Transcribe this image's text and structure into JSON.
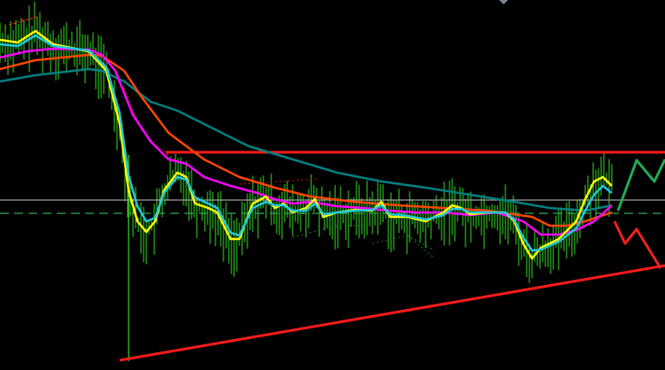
{
  "chart_data": {
    "type": "line",
    "title": "",
    "xlabel": "",
    "ylabel": "",
    "xlim": [
      0,
      150
    ],
    "ylim": [
      0,
      418
    ],
    "grid": false,
    "legend": "none",
    "background": "#000000",
    "bar_color": "#33dd22",
    "series": [
      {
        "name": "slow-ma-teal",
        "color": "#008080",
        "width": 2.5,
        "points": [
          [
            0,
            326
          ],
          [
            8,
            333
          ],
          [
            20,
            340
          ],
          [
            23,
            338
          ],
          [
            28,
            326
          ],
          [
            34,
            303
          ],
          [
            40,
            293
          ],
          [
            48,
            273
          ],
          [
            56,
            253
          ],
          [
            66,
            238
          ],
          [
            76,
            223
          ],
          [
            86,
            213
          ],
          [
            96,
            206
          ],
          [
            106,
            198
          ],
          [
            116,
            190
          ],
          [
            124,
            183
          ],
          [
            132,
            180
          ],
          [
            138,
            186
          ]
        ]
      },
      {
        "name": "ma-orange",
        "color": "#ff4500",
        "width": 2.5,
        "points": [
          [
            0,
            340
          ],
          [
            8,
            350
          ],
          [
            20,
            356
          ],
          [
            23,
            355
          ],
          [
            28,
            338
          ],
          [
            32,
            308
          ],
          [
            38,
            268
          ],
          [
            46,
            238
          ],
          [
            54,
            218
          ],
          [
            62,
            206
          ],
          [
            70,
            196
          ],
          [
            80,
            190
          ],
          [
            90,
            186
          ],
          [
            100,
            183
          ],
          [
            110,
            180
          ],
          [
            120,
            173
          ],
          [
            124,
            163
          ],
          [
            128,
            163
          ],
          [
            132,
            168
          ],
          [
            138,
            178
          ]
        ]
      },
      {
        "name": "ma-magenta",
        "color": "#ff00ff",
        "width": 2.5,
        "points": [
          [
            0,
            353
          ],
          [
            6,
            360
          ],
          [
            12,
            363
          ],
          [
            20,
            362
          ],
          [
            23,
            356
          ],
          [
            26,
            338
          ],
          [
            30,
            288
          ],
          [
            34,
            258
          ],
          [
            38,
            238
          ],
          [
            42,
            233
          ],
          [
            46,
            218
          ],
          [
            52,
            208
          ],
          [
            58,
            200
          ],
          [
            62,
            193
          ],
          [
            66,
            188
          ],
          [
            70,
            190
          ],
          [
            76,
            185
          ],
          [
            82,
            183
          ],
          [
            88,
            180
          ],
          [
            94,
            178
          ],
          [
            100,
            178
          ],
          [
            106,
            175
          ],
          [
            112,
            178
          ],
          [
            118,
            168
          ],
          [
            122,
            153
          ],
          [
            126,
            153
          ],
          [
            130,
            158
          ],
          [
            134,
            168
          ],
          [
            138,
            186
          ]
        ]
      },
      {
        "name": "fast-ma-yellow",
        "color": "#ffff00",
        "width": 2.5,
        "points": [
          [
            0,
            373
          ],
          [
            4,
            370
          ],
          [
            8,
            383
          ],
          [
            12,
            368
          ],
          [
            20,
            360
          ],
          [
            24,
            338
          ],
          [
            27,
            278
          ],
          [
            29,
            203
          ],
          [
            31,
            168
          ],
          [
            33,
            156
          ],
          [
            35,
            168
          ],
          [
            37,
            203
          ],
          [
            40,
            223
          ],
          [
            42,
            218
          ],
          [
            44,
            188
          ],
          [
            47,
            183
          ],
          [
            49,
            178
          ],
          [
            52,
            148
          ],
          [
            54,
            148
          ],
          [
            57,
            188
          ],
          [
            60,
            196
          ],
          [
            62,
            183
          ],
          [
            64,
            188
          ],
          [
            66,
            178
          ],
          [
            69,
            183
          ],
          [
            71,
            193
          ],
          [
            73,
            173
          ],
          [
            76,
            178
          ],
          [
            80,
            181
          ],
          [
            84,
            180
          ],
          [
            86,
            190
          ],
          [
            88,
            173
          ],
          [
            92,
            173
          ],
          [
            96,
            168
          ],
          [
            100,
            178
          ],
          [
            102,
            186
          ],
          [
            104,
            183
          ],
          [
            106,
            176
          ],
          [
            110,
            178
          ],
          [
            114,
            178
          ],
          [
            116,
            168
          ],
          [
            118,
            143
          ],
          [
            120,
            126
          ],
          [
            122,
            138
          ],
          [
            126,
            148
          ],
          [
            130,
            168
          ],
          [
            132,
            193
          ],
          [
            134,
            213
          ],
          [
            136,
            218
          ],
          [
            138,
            208
          ]
        ]
      },
      {
        "name": "fast-ma-cyan",
        "color": "#20c8d8",
        "width": 2.5,
        "points": [
          [
            0,
            368
          ],
          [
            4,
            366
          ],
          [
            8,
            378
          ],
          [
            12,
            366
          ],
          [
            20,
            361
          ],
          [
            24,
            342
          ],
          [
            27,
            290
          ],
          [
            29,
            220
          ],
          [
            31,
            185
          ],
          [
            33,
            168
          ],
          [
            35,
            172
          ],
          [
            37,
            200
          ],
          [
            40,
            218
          ],
          [
            42,
            215
          ],
          [
            44,
            195
          ],
          [
            47,
            188
          ],
          [
            49,
            183
          ],
          [
            52,
            155
          ],
          [
            54,
            152
          ],
          [
            57,
            183
          ],
          [
            60,
            190
          ],
          [
            62,
            186
          ],
          [
            64,
            186
          ],
          [
            66,
            180
          ],
          [
            69,
            180
          ],
          [
            71,
            188
          ],
          [
            73,
            176
          ],
          [
            76,
            178
          ],
          [
            80,
            180
          ],
          [
            84,
            181
          ],
          [
            86,
            186
          ],
          [
            88,
            176
          ],
          [
            92,
            174
          ],
          [
            96,
            170
          ],
          [
            100,
            175
          ],
          [
            102,
            182
          ],
          [
            104,
            182
          ],
          [
            106,
            178
          ],
          [
            110,
            178
          ],
          [
            114,
            178
          ],
          [
            116,
            170
          ],
          [
            118,
            150
          ],
          [
            120,
            135
          ],
          [
            122,
            136
          ],
          [
            126,
            145
          ],
          [
            130,
            160
          ],
          [
            132,
            180
          ],
          [
            134,
            198
          ],
          [
            136,
            208
          ],
          [
            138,
            200
          ]
        ]
      }
    ],
    "levels": [
      {
        "name": "resistance-line",
        "color": "#ff1a1a",
        "width": 3,
        "from": [
          37.4,
          246
        ],
        "to": [
          150,
          246
        ]
      },
      {
        "name": "grey-horizontal-line",
        "color": "#a0a0a0",
        "width": 1.2,
        "from": [
          0,
          192
        ],
        "to": [
          150,
          192
        ]
      },
      {
        "name": "green-dashed-line",
        "color": "#2eaa5a",
        "width": 1.2,
        "dash": "10,6",
        "from": [
          0,
          177
        ],
        "to": [
          150,
          177
        ]
      },
      {
        "name": "support-trendline",
        "color": "#ff1a1a",
        "width": 3,
        "from": [
          27,
          11
        ],
        "to": [
          150,
          118
        ]
      },
      {
        "name": "top-red-dashed-line",
        "color": "#ff2020",
        "width": 1.2,
        "dash": "3,2",
        "from": [
          2,
          390
        ],
        "to": [
          8.4,
          399
        ]
      }
    ],
    "projections": [
      {
        "name": "green-zigzag-projection",
        "color": "#22aa55",
        "width": 3,
        "points": [
          [
            139.4,
            180
          ],
          [
            143.6,
            237
          ],
          [
            147.6,
            213
          ],
          [
            150,
            238
          ]
        ]
      },
      {
        "name": "red-zigzag-projection",
        "color": "#ee2222",
        "width": 3,
        "points": [
          [
            138.6,
            168
          ],
          [
            141,
            143
          ],
          [
            143.6,
            159
          ],
          [
            149,
            115
          ]
        ]
      }
    ],
    "dotted_lines": [
      {
        "name": "red-dotted-curve",
        "color": "#cc1010",
        "points": [
          [
            28,
            318
          ],
          [
            32,
            270
          ],
          [
            36,
            250
          ],
          [
            40,
            236
          ]
        ]
      },
      {
        "name": "red-dotted-segment",
        "color": "#cc1010",
        "points": [
          [
            54,
            210
          ],
          [
            72,
            216
          ]
        ]
      },
      {
        "name": "dark-green-dotted-1",
        "color": "#1a7a1a",
        "points": [
          [
            66,
            150
          ],
          [
            76,
            163
          ],
          [
            82,
            163
          ]
        ]
      },
      {
        "name": "dark-green-dotted-2",
        "color": "#1a7a1a",
        "points": [
          [
            84,
            143
          ],
          [
            92,
            152
          ],
          [
            98,
            135
          ]
        ]
      },
      {
        "name": "dark-green-dotted-3",
        "color": "#1a7a1a",
        "points": [
          [
            92,
            152
          ],
          [
            98,
            126
          ]
        ]
      }
    ]
  }
}
